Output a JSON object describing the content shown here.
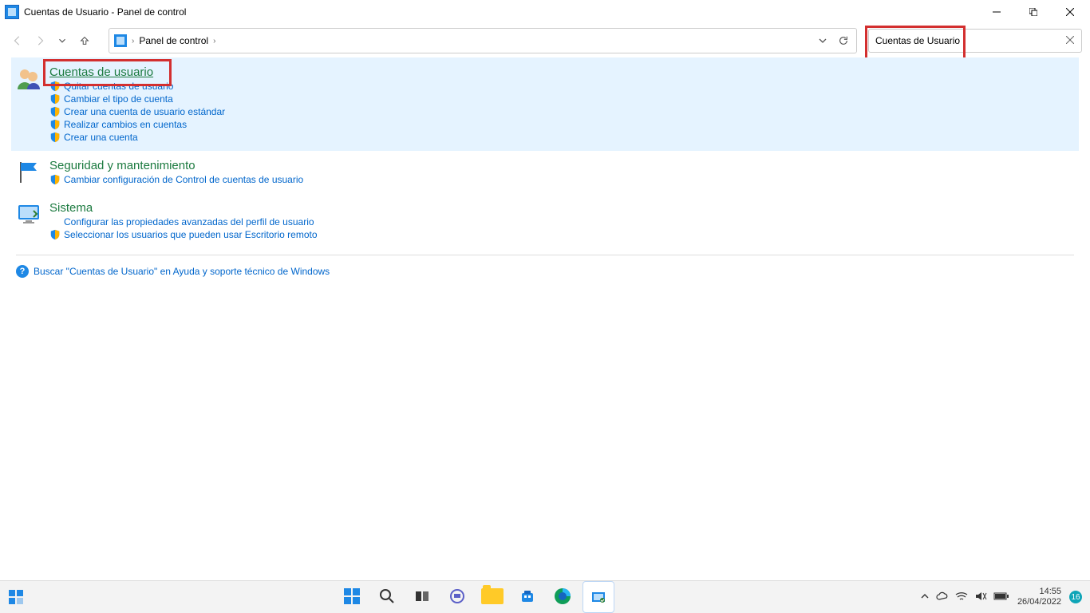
{
  "window": {
    "title": "Cuentas de Usuario - Panel de control"
  },
  "breadcrumb": {
    "root": "Panel de control"
  },
  "search": {
    "value": "Cuentas de Usuario"
  },
  "addr_tools": {
    "down": "⌄",
    "refresh": "↻"
  },
  "groups": [
    {
      "id": "cuentas",
      "title": "Cuentas de usuario",
      "highlighted": true,
      "selected": true,
      "title_underline": true,
      "links": [
        {
          "shield": true,
          "label": "Quitar cuentas de usuario"
        },
        {
          "shield": true,
          "label": "Cambiar el tipo de cuenta"
        },
        {
          "shield": true,
          "label": "Crear una cuenta de usuario estándar"
        },
        {
          "shield": true,
          "label": "Realizar cambios en cuentas"
        },
        {
          "shield": true,
          "label": "Crear una cuenta"
        }
      ]
    },
    {
      "id": "seguridad",
      "title": "Seguridad y mantenimiento",
      "links": [
        {
          "shield": true,
          "label": "Cambiar configuración de Control de cuentas de usuario"
        }
      ]
    },
    {
      "id": "sistema",
      "title": "Sistema",
      "links": [
        {
          "shield": false,
          "label": "Configurar las propiedades avanzadas del perfil de usuario"
        },
        {
          "shield": true,
          "label": "Seleccionar los usuarios que pueden usar Escritorio remoto"
        }
      ]
    }
  ],
  "help": {
    "label": "Buscar \"Cuentas de Usuario\" en Ayuda y soporte técnico de Windows"
  },
  "tray": {
    "time": "14:55",
    "date": "26/04/2022",
    "badge": "16"
  }
}
